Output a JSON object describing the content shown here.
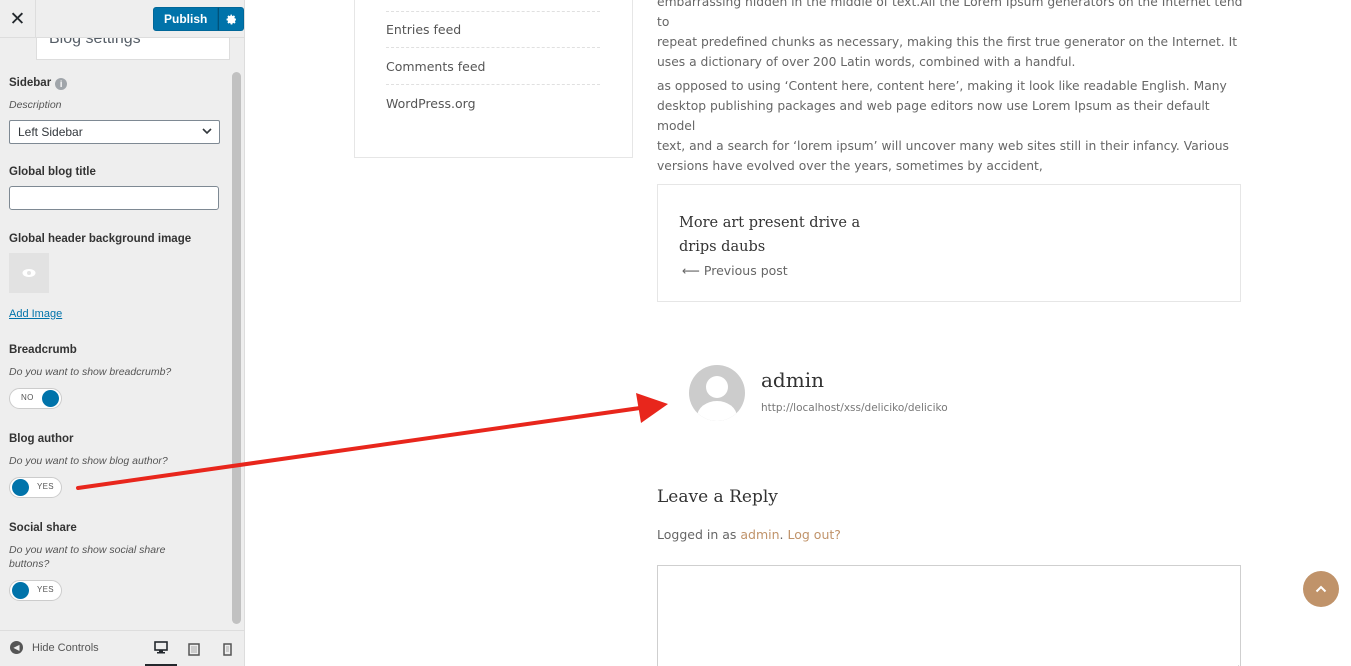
{
  "customizer": {
    "close_icon": "close-icon",
    "publish_label": "Publish",
    "publish_settings_icon": "gear-icon",
    "section_title": "Blog settings",
    "sidebar": {
      "label": "Sidebar",
      "info_icon": "info-icon",
      "description": "Description",
      "selected": "Left Sidebar"
    },
    "global_blog_title": {
      "label": "Global blog title",
      "value": ""
    },
    "header_bg_image": {
      "label": "Global header background image",
      "add_label": "Add Image"
    },
    "breadcrumb": {
      "label": "Breadcrumb",
      "description": "Do you want to show breadcrumb?",
      "state": "NO"
    },
    "blog_author": {
      "label": "Blog author",
      "description": "Do you want to show blog author?",
      "state": "YES"
    },
    "social_share": {
      "label": "Social share",
      "description": "Do you want to show social share buttons?",
      "state": "YES"
    },
    "footer": {
      "hide_controls": "Hide Controls",
      "devices": [
        "desktop-icon",
        "tablet-icon",
        "mobile-icon"
      ]
    }
  },
  "preview": {
    "meta_links": [
      "Entries feed",
      "Comments feed",
      "WordPress.org"
    ],
    "paragraph1_lines": [
      "embarrassing hidden in the middle of text.All the Lorem Ipsum generators on the Internet tend to",
      "repeat predefined chunks as necessary, making this the first true generator on the Internet. It",
      "uses a dictionary of over 200 Latin words, combined with a handful."
    ],
    "paragraph2_lines": [
      "as opposed to using ‘Content here, content here’, making it look like readable English. Many",
      "desktop publishing packages and web page editors now use Lorem Ipsum as their default model",
      "text, and a search for ‘lorem ipsum’ will uncover many web sites still in their infancy. Various",
      "versions have evolved over the years, sometimes by accident,"
    ],
    "post_nav": {
      "title": "More art present drive a drips daubs",
      "prev_label": "⟵ Previous post"
    },
    "author": {
      "name": "admin",
      "url": "http://localhost/xss/deliciko/deliciko"
    },
    "reply": {
      "heading": "Leave a Reply",
      "logged_in_prefix": "Logged in as ",
      "user": "admin",
      "separator": ". ",
      "logout": "Log out?"
    },
    "scroll_top_icon": "chevron-up-icon"
  },
  "colors": {
    "wp_blue": "#0073aa",
    "accent": "#c0936a",
    "annotation_red": "#e8261c"
  }
}
